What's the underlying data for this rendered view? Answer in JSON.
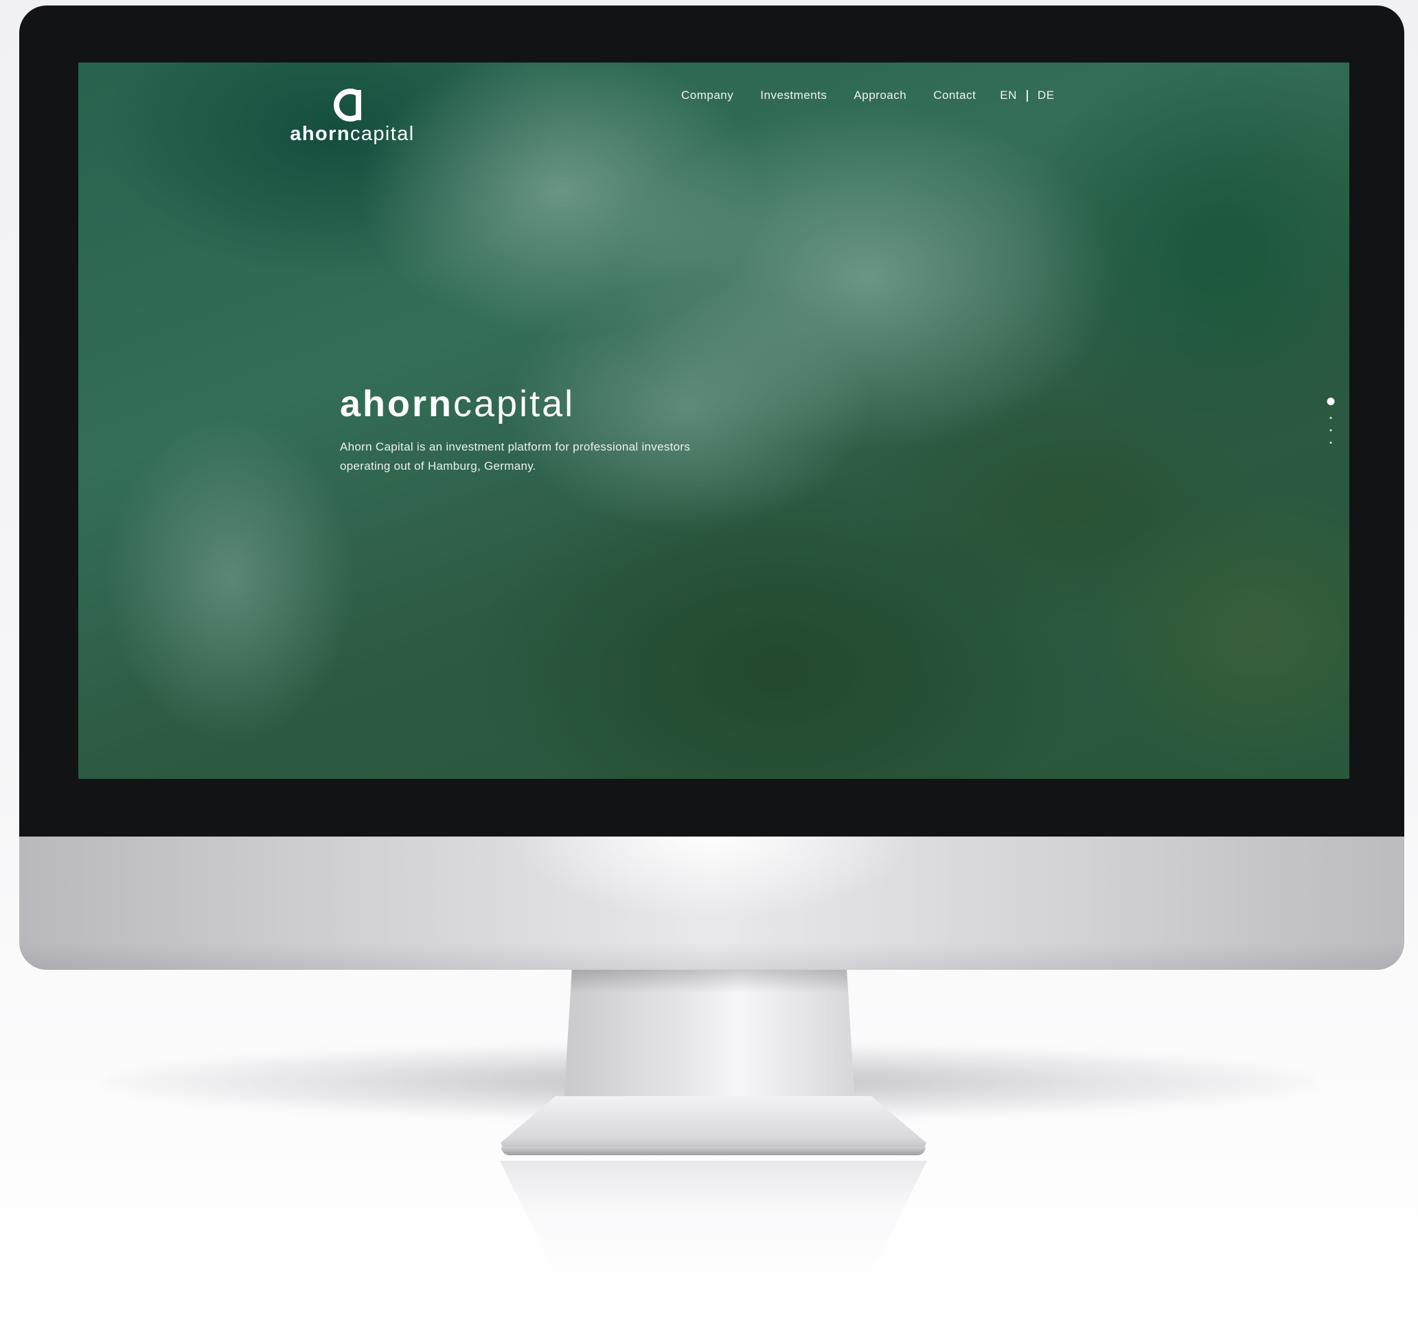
{
  "site": {
    "brand": {
      "part1": "ahorn",
      "part2": "capital",
      "mark": "a"
    },
    "nav": [
      {
        "label": "Company"
      },
      {
        "label": "Investments"
      },
      {
        "label": "Approach"
      },
      {
        "label": "Contact"
      }
    ],
    "languages": {
      "en": "EN",
      "de": "DE"
    },
    "hero": {
      "title_part1": "ahorn",
      "title_part2": "capital",
      "description": "Ahorn Capital is an investment platform for professional investors operating out of Hamburg, Germany."
    },
    "slider": {
      "count": 4,
      "active_index": 0
    }
  },
  "colors": {
    "bezel": "#121314",
    "text": "#ffffff",
    "screen_base": "#2c6a56"
  },
  "icons": {
    "logo_mark": "letter-a-logo-icon",
    "slider_dot_active": "filled-circle",
    "slider_dot": "small-dot"
  }
}
